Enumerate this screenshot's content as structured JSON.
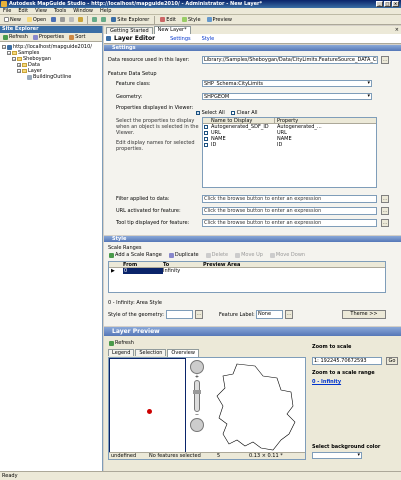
{
  "window": {
    "title": "Autodesk MapGuide Studio - http://localhost/mapguide2010/ - Administrator - New Layer*"
  },
  "menu": [
    "File",
    "Edit",
    "View",
    "Tools",
    "Window",
    "Help"
  ],
  "toolbar": {
    "new": "New",
    "open": "Open",
    "site_explorer": "Site Explorer",
    "edit": "Edit",
    "style": "Style",
    "preview": "Preview"
  },
  "site_explorer": {
    "title": "Site Explorer",
    "refresh": "Refresh",
    "properties": "Properties",
    "sort": "Sort",
    "tree": [
      {
        "label": "http://localhost/mapguide2010/",
        "level": 0
      },
      {
        "label": "Samples",
        "level": 1
      },
      {
        "label": "Sheboygan",
        "level": 2
      },
      {
        "label": "Data",
        "level": 3
      },
      {
        "label": "Layer",
        "level": 3
      },
      {
        "label": "BuildingOutline",
        "level": 4
      }
    ]
  },
  "tabs": [
    "Getting Started",
    "New Layer*"
  ],
  "editor": {
    "title": "Layer Editor",
    "settings_tab": "Settings",
    "style_tab": "Style"
  },
  "settings": {
    "header": "Settings",
    "data_resource_label": "Data resource used in this layer:",
    "data_resource_value": "Library://Samples/Sheboygan/Data/CityLimits.FeatureSource_DATA_CityLimits.FeatureSource",
    "feature_data_setup": "Feature Data Setup",
    "feature_class_label": "Feature class:",
    "feature_class_value": "SHP_Schema:CityLimits",
    "geometry_label": "Geometry:",
    "geometry_value": "SHPGEOM",
    "props_label": "Properties displayed in Viewer:",
    "select_all": "Select All",
    "clear_all": "Clear All",
    "help_text": [
      "Select the properties to display",
      "when an object is selected in the",
      "Viewer.",
      "",
      "Edit display names for selected",
      "properties."
    ],
    "prop_headers": [
      "Name to Display",
      "Property"
    ],
    "prop_rows": [
      {
        "name": "Autogenerated_SDF_ID",
        "property": "Autogenerated_..."
      },
      {
        "name": "URL",
        "property": "URL"
      },
      {
        "name": "NAME",
        "property": "NAME"
      },
      {
        "name": "ID",
        "property": "ID"
      }
    ],
    "filter_label": "Filter applied to data:",
    "url_label": "URL activated for feature:",
    "tooltip_label": "Tool tip displayed for feature:",
    "expr_placeholder": "Click the browse button to enter an expression"
  },
  "style": {
    "header": "Style",
    "scale_ranges": "Scale Ranges",
    "add_range": "Add a Scale Range",
    "duplicate": "Duplicate",
    "delete": "Delete",
    "move_up": "Move Up",
    "move_down": "Move Down",
    "col_from": "From",
    "col_to": "To",
    "col_preview": "Preview Area",
    "row_from": "0",
    "row_to": "Infinity",
    "area_style_title": "0 - Infinity: Area Style",
    "style_label": "Style of the geometry:",
    "feature_label": "Feature Label:",
    "feature_label_value": "None",
    "theme_button": "Theme >>"
  },
  "preview": {
    "header": "Layer Preview",
    "refresh": "Refresh",
    "tabs": [
      "Legend",
      "Selection",
      "Overview"
    ],
    "zoom_to_scale": "Zoom to scale",
    "scale_value": "1: 192245.70672593",
    "go": "Go",
    "zoom_to_range": "Zoom to a scale range",
    "range_link": "0 - Infinity",
    "background_label": "Select background color",
    "status_left": "undefined",
    "status_mid": "No features selected",
    "status_num": "5",
    "status_right": "0.13 × 0.11 *"
  },
  "statusbar": "Ready"
}
